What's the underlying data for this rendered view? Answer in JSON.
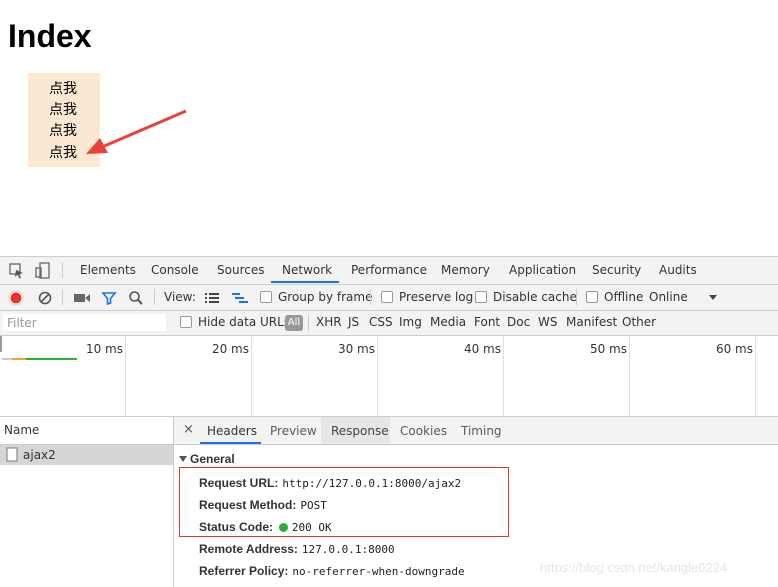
{
  "page": {
    "title": "Index",
    "links": [
      "点我",
      "点我",
      "点我",
      "点我"
    ]
  },
  "devtools": {
    "tabs": [
      "Elements",
      "Console",
      "Sources",
      "Network",
      "Performance",
      "Memory",
      "Application",
      "Security",
      "Audits"
    ],
    "active_tab": "Network",
    "toolbar": {
      "view_label": "View:",
      "group_by_frame": "Group by frame",
      "preserve_log": "Preserve log",
      "disable_cache": "Disable cache",
      "offline": "Offline",
      "throttle": "Online"
    },
    "filter": {
      "placeholder": "Filter",
      "hide_data_urls": "Hide data URLs",
      "types": [
        "All",
        "XHR",
        "JS",
        "CSS",
        "Img",
        "Media",
        "Font",
        "Doc",
        "WS",
        "Manifest",
        "Other"
      ]
    },
    "timeline_ticks": [
      "10 ms",
      "20 ms",
      "30 ms",
      "40 ms",
      "50 ms",
      "60 ms"
    ],
    "requests": {
      "column_name": "Name",
      "items": [
        "ajax2"
      ]
    },
    "detail_tabs": [
      "Headers",
      "Preview",
      "Response",
      "Cookies",
      "Timing"
    ],
    "general": {
      "section_label": "General",
      "request_url_key": "Request URL:",
      "request_url": "http://127.0.0.1:8000/ajax2",
      "request_method_key": "Request Method:",
      "request_method": "POST",
      "status_code_key": "Status Code:",
      "status_code": "200  OK",
      "remote_address_key": "Remote Address:",
      "remote_address": "127.0.0.1:8000",
      "referrer_policy_key": "Referrer Policy:",
      "referrer_policy": "no-referrer-when-downgrade"
    }
  },
  "watermark": "https://blog.csdn.net/kangle0224",
  "colors": {
    "accent": "#1a73e8",
    "record": "#e0392b",
    "status_ok": "#2dae3b",
    "link_bg": "#fbe8d3",
    "arrow": "#e8413a"
  }
}
